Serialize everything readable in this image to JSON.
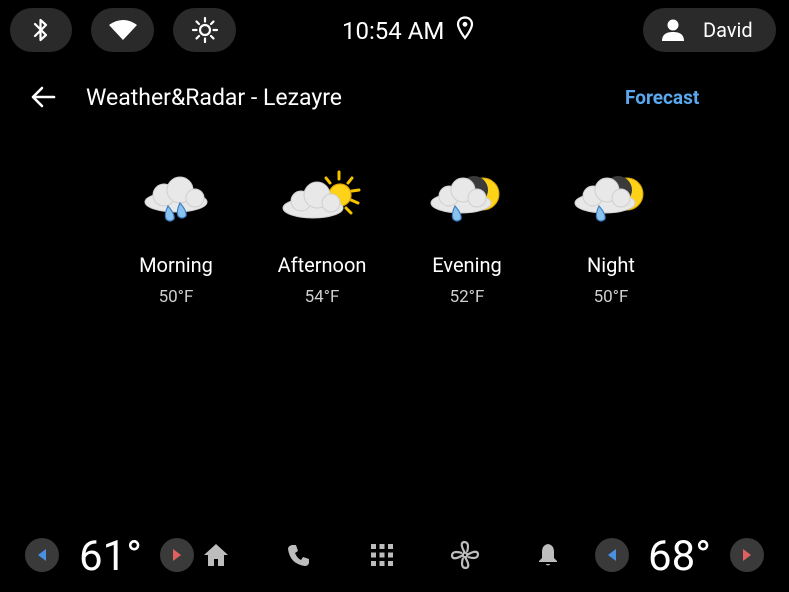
{
  "status_bar": {
    "time": "10:54 AM",
    "user_name": "David"
  },
  "header": {
    "title": "Weather&Radar - Lezayre",
    "action_label": "Forecast"
  },
  "forecast": [
    {
      "label": "Morning",
      "temp": "50°F",
      "icon": "rain-cloud-icon"
    },
    {
      "label": "Afternoon",
      "temp": "54°F",
      "icon": "partly-sunny-icon"
    },
    {
      "label": "Evening",
      "temp": "52°F",
      "icon": "rain-night-icon"
    },
    {
      "label": "Night",
      "temp": "50°F",
      "icon": "rain-night-icon"
    }
  ],
  "climate": {
    "left_temp": "61°",
    "right_temp": "68°"
  },
  "colors": {
    "accent": "#5aa9ef",
    "background": "#000000",
    "pill": "#2a2a2a",
    "arrow_left": "#4a90e2",
    "arrow_right": "#e06060"
  }
}
